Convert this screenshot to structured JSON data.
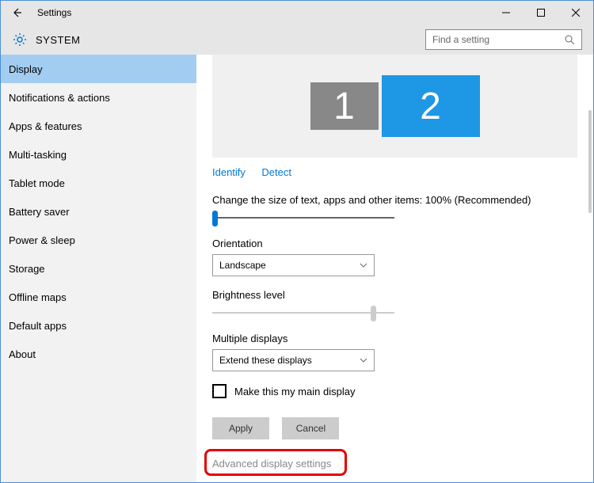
{
  "titlebar": {
    "title": "Settings"
  },
  "header": {
    "section": "SYSTEM",
    "search_placeholder": "Find a setting"
  },
  "sidebar": {
    "items": [
      {
        "label": "Display",
        "selected": true
      },
      {
        "label": "Notifications & actions",
        "selected": false
      },
      {
        "label": "Apps & features",
        "selected": false
      },
      {
        "label": "Multi-tasking",
        "selected": false
      },
      {
        "label": "Tablet mode",
        "selected": false
      },
      {
        "label": "Battery saver",
        "selected": false
      },
      {
        "label": "Power & sleep",
        "selected": false
      },
      {
        "label": "Storage",
        "selected": false
      },
      {
        "label": "Offline maps",
        "selected": false
      },
      {
        "label": "Default apps",
        "selected": false
      },
      {
        "label": "About",
        "selected": false
      }
    ]
  },
  "main": {
    "monitors": {
      "m1": "1",
      "m2": "2"
    },
    "identify": "Identify",
    "detect": "Detect",
    "size_label": "Change the size of text, apps and other items: 100% (Recommended)",
    "orientation_label": "Orientation",
    "orientation_value": "Landscape",
    "brightness_label": "Brightness level",
    "multiple_label": "Multiple displays",
    "multiple_value": "Extend these displays",
    "checkbox_label": "Make this my main display",
    "apply": "Apply",
    "cancel": "Cancel",
    "advanced": "Advanced display settings"
  }
}
